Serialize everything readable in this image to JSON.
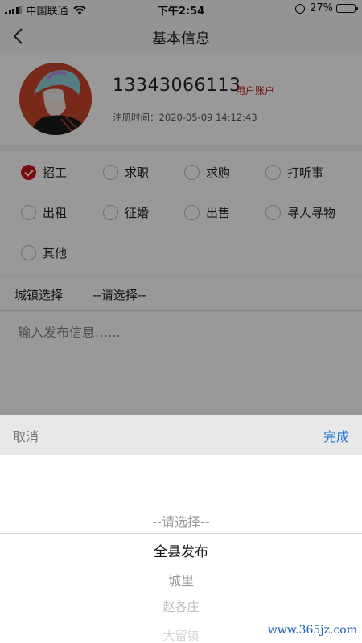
{
  "status_bar": {
    "carrier": "中国联通",
    "time": "下午2:54",
    "battery_percent": "27%",
    "battery_level": 0.27,
    "icons": [
      "signal-icon",
      "wifi-icon",
      "orientation-lock-icon",
      "battery-icon"
    ]
  },
  "nav": {
    "title": "基本信息",
    "back_icon": "chevron-left-icon"
  },
  "profile": {
    "phone": "13343066113",
    "account_type": "用户账户",
    "register_time": "注册时间：2020-05-09 14:12:43"
  },
  "categories": [
    {
      "label": "招工",
      "checked": true
    },
    {
      "label": "求职",
      "checked": false
    },
    {
      "label": "求购",
      "checked": false
    },
    {
      "label": "打听事",
      "checked": false
    },
    {
      "label": "出租",
      "checked": false
    },
    {
      "label": "征婚",
      "checked": false
    },
    {
      "label": "出售",
      "checked": false
    },
    {
      "label": "寻人寻物",
      "checked": false
    },
    {
      "label": "其他",
      "checked": false
    }
  ],
  "town": {
    "label": "城镇选择",
    "value": "--请选择--"
  },
  "message": {
    "placeholder": "输入发布信息……"
  },
  "picker": {
    "cancel_label": "取消",
    "done_label": "完成",
    "options": [
      "--请选择--",
      "全县发布",
      "城里",
      "赵各庄",
      "大留镇"
    ],
    "selected": "全县发布"
  },
  "watermark": "www.365jz.com",
  "colors": {
    "accent_red": "#c9141a",
    "done_blue": "#1a78d6"
  }
}
